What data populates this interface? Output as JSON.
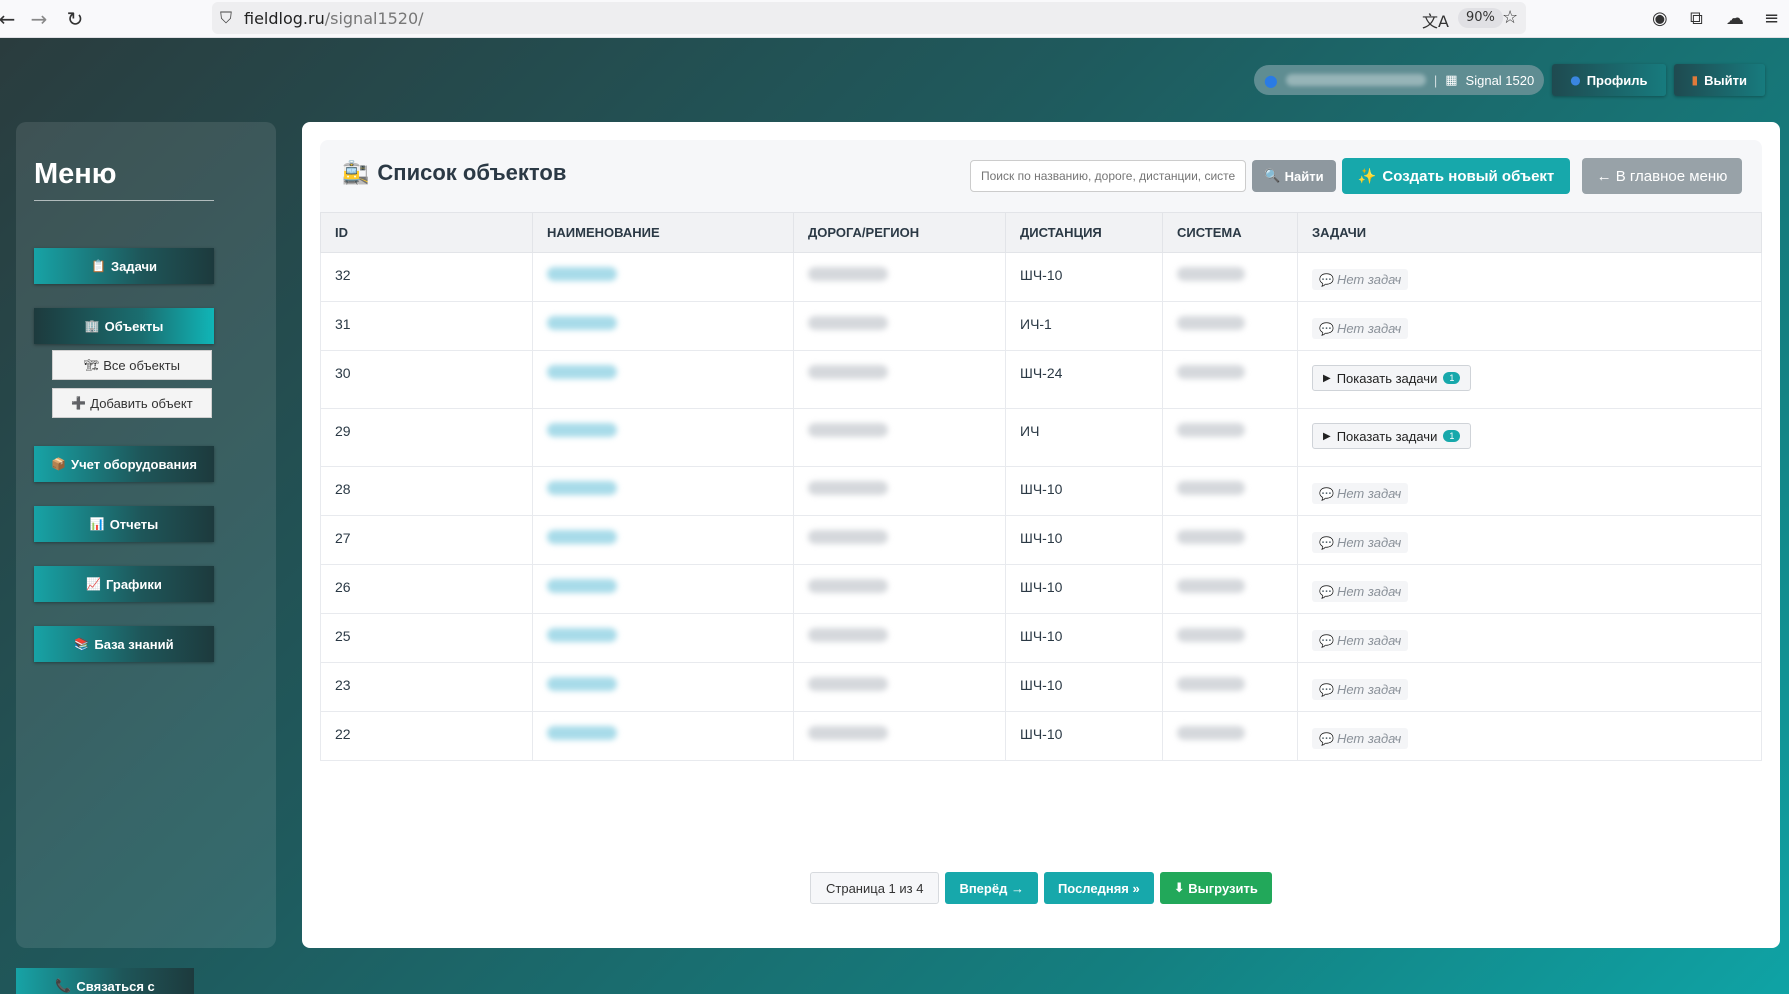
{
  "browser": {
    "url_host": "fieldlog.ru",
    "url_path": "/signal1520/",
    "zoom": "90%"
  },
  "topbar": {
    "org": "Signal 1520",
    "profile_label": "Профиль",
    "logout_label": "Выйти"
  },
  "sidebar": {
    "title": "Меню",
    "items": [
      {
        "label": "Задачи",
        "icon": "clipboard-icon"
      },
      {
        "label": "Объекты",
        "icon": "building-icon"
      },
      {
        "label": "Все объекты",
        "icon": "crane-icon"
      },
      {
        "label": "Добавить объект",
        "icon": "plus-icon"
      },
      {
        "label": "Учет оборудования",
        "icon": "package-icon"
      },
      {
        "label": "Отчеты",
        "icon": "bar-chart-icon"
      },
      {
        "label": "Графики",
        "icon": "line-chart-icon"
      },
      {
        "label": "База знаний",
        "icon": "books-icon"
      }
    ],
    "contact_label": "Связаться с"
  },
  "main": {
    "title": "Список объектов",
    "search_placeholder": "Поиск по названию, дороге, дистанции, системе",
    "find_label": "Найти",
    "create_label": "Создать новый объект",
    "home_label": "← В главное меню",
    "columns": [
      "ID",
      "НАИМЕНОВАНИЕ",
      "ДОРОГА/РЕГИОН",
      "ДИСТАНЦИЯ",
      "СИСТЕМА",
      "ЗАДАЧИ"
    ],
    "rows": [
      {
        "id": "32",
        "distance": "ШЧ-10",
        "tasks": "none"
      },
      {
        "id": "31",
        "distance": "ИЧ-1",
        "tasks": "none"
      },
      {
        "id": "30",
        "distance": "ШЧ-24",
        "tasks": "show",
        "count": "1"
      },
      {
        "id": "29",
        "distance": "ИЧ",
        "tasks": "show",
        "count": "1"
      },
      {
        "id": "28",
        "distance": "ШЧ-10",
        "tasks": "none"
      },
      {
        "id": "27",
        "distance": "ШЧ-10",
        "tasks": "none"
      },
      {
        "id": "26",
        "distance": "ШЧ-10",
        "tasks": "none"
      },
      {
        "id": "25",
        "distance": "ШЧ-10",
        "tasks": "none"
      },
      {
        "id": "23",
        "distance": "ШЧ-10",
        "tasks": "none"
      },
      {
        "id": "22",
        "distance": "ШЧ-10",
        "tasks": "none"
      }
    ],
    "no_tasks_label": "Нет задач",
    "show_tasks_label": "Показать задачи"
  },
  "pagination": {
    "info": "Страница 1 из 4",
    "next_label": "Вперёд →",
    "last_label": "Последняя »",
    "export_label": "Выгрузить"
  },
  "colors": {
    "accent": "#17a8ab",
    "export": "#22a85a"
  }
}
